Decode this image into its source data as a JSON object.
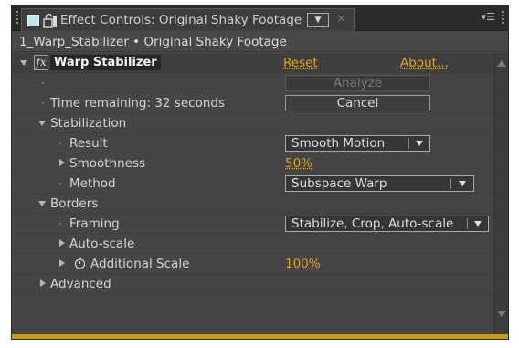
{
  "tab": {
    "title": "Effect Controls: Original Shaky Footage",
    "menu_icon": "dropdown-menu-icon",
    "close_icon": "close-icon",
    "panel_menu_icon": "panel-menu-icon"
  },
  "subheader": "1_Warp_Stabilizer • Original Shaky Footage",
  "effect": {
    "name": "Warp Stabilizer",
    "fx_label": "fx",
    "reset_label": "Reset",
    "about_label": "About..."
  },
  "analyze_label": "Analyze",
  "time_remaining": "Time remaining: 32 seconds",
  "cancel_label": "Cancel",
  "stabilization": {
    "label": "Stabilization",
    "result_label": "Result",
    "result_value": "Smooth Motion",
    "smoothness_label": "Smoothness",
    "smoothness_value": "50%",
    "method_label": "Method",
    "method_value": "Subspace Warp"
  },
  "borders": {
    "label": "Borders",
    "framing_label": "Framing",
    "framing_value": "Stabilize, Crop, Auto-scale",
    "autoscale_label": "Auto-scale",
    "additional_scale_label": "Additional Scale",
    "additional_scale_value": "100%"
  },
  "advanced_label": "Advanced",
  "colors": {
    "panel_bg": "#454545",
    "accent_value": "#d9a520",
    "tab_icon": "#c2e6e8",
    "focus_border": "#c79a18"
  }
}
